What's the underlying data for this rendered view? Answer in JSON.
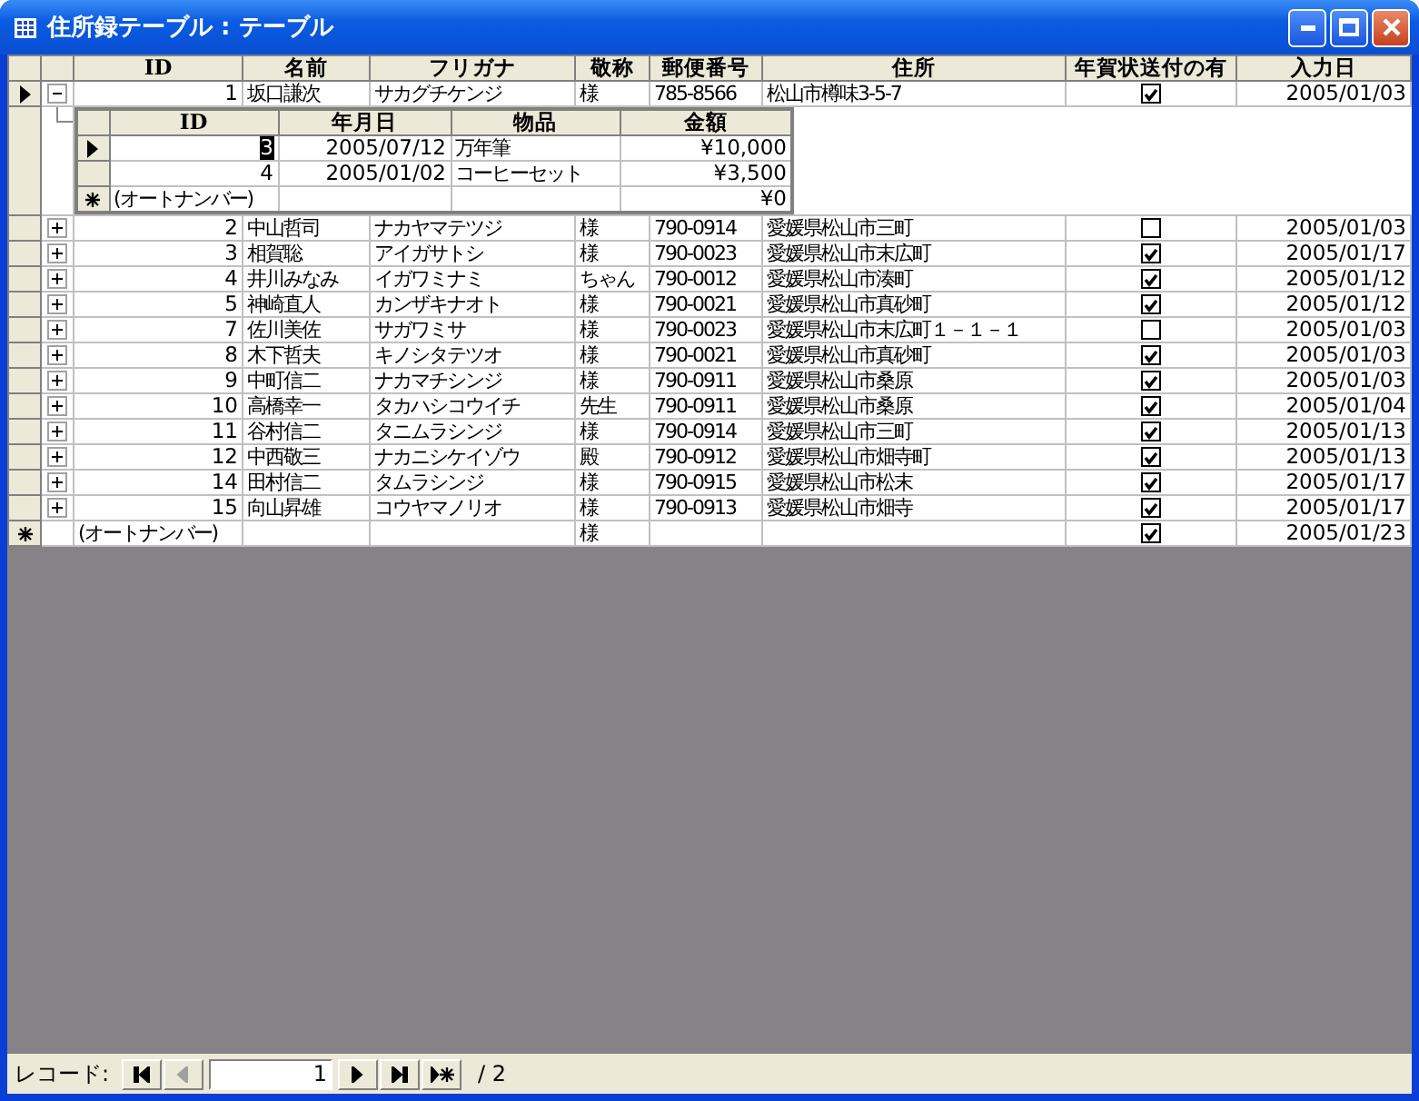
{
  "window": {
    "title": "住所録テーブル : テーブル"
  },
  "table": {
    "columns": [
      "ID",
      "名前",
      "フリガナ",
      "敬称",
      "郵便番号",
      "住所",
      "年賀状送付の有",
      "入力日"
    ],
    "rows": [
      {
        "kind": "record",
        "current": true,
        "expanded": true,
        "id": "1",
        "name": "坂口謙次",
        "kana": "サカグチケンジ",
        "title": "様",
        "zip": "785-8566",
        "address": "松山市樽味3-5-7",
        "nenga": true,
        "date": "2005/01/03",
        "subtable": {
          "columns": [
            "ID",
            "年月日",
            "物品",
            "金額"
          ],
          "rows": [
            {
              "kind": "record",
              "current": true,
              "id": "3",
              "date": "2005/07/12",
              "item": "万年筆",
              "amount": "¥10,000"
            },
            {
              "kind": "record",
              "current": false,
              "id": "4",
              "date": "2005/01/02",
              "item": "コーヒーセット",
              "amount": "¥3,500"
            },
            {
              "kind": "new",
              "current": false,
              "id": "(オートナンバー)",
              "date": "",
              "item": "",
              "amount": "¥0"
            }
          ]
        }
      },
      {
        "kind": "record",
        "current": false,
        "expanded": false,
        "id": "2",
        "name": "中山哲司",
        "kana": "ナカヤマテツジ",
        "title": "様",
        "zip": "790-0914",
        "address": "愛媛県松山市三町",
        "nenga": false,
        "date": "2005/01/03"
      },
      {
        "kind": "record",
        "current": false,
        "expanded": false,
        "id": "3",
        "name": "相賀聡",
        "kana": "アイガサトシ",
        "title": "様",
        "zip": "790-0023",
        "address": "愛媛県松山市末広町",
        "nenga": true,
        "date": "2005/01/17"
      },
      {
        "kind": "record",
        "current": false,
        "expanded": false,
        "id": "4",
        "name": "井川みなみ",
        "kana": "イガワミナミ",
        "title": "ちゃん",
        "zip": "790-0012",
        "address": "愛媛県松山市湊町",
        "nenga": true,
        "date": "2005/01/12"
      },
      {
        "kind": "record",
        "current": false,
        "expanded": false,
        "id": "5",
        "name": "神崎直人",
        "kana": "カンザキナオト",
        "title": "様",
        "zip": "790-0021",
        "address": "愛媛県松山市真砂町",
        "nenga": true,
        "date": "2005/01/12"
      },
      {
        "kind": "record",
        "current": false,
        "expanded": false,
        "id": "7",
        "name": "佐川美佐",
        "kana": "サガワミサ",
        "title": "様",
        "zip": "790-0023",
        "address": "愛媛県松山市末広町１－１－１",
        "nenga": false,
        "date": "2005/01/03"
      },
      {
        "kind": "record",
        "current": false,
        "expanded": false,
        "id": "8",
        "name": "木下哲夫",
        "kana": "キノシタテツオ",
        "title": "様",
        "zip": "790-0021",
        "address": "愛媛県松山市真砂町",
        "nenga": true,
        "date": "2005/01/03"
      },
      {
        "kind": "record",
        "current": false,
        "expanded": false,
        "id": "9",
        "name": "中町信二",
        "kana": "ナカマチシンジ",
        "title": "様",
        "zip": "790-0911",
        "address": "愛媛県松山市桑原",
        "nenga": true,
        "date": "2005/01/03"
      },
      {
        "kind": "record",
        "current": false,
        "expanded": false,
        "id": "10",
        "name": "高橋幸一",
        "kana": "タカハシコウイチ",
        "title": "先生",
        "zip": "790-0911",
        "address": "愛媛県松山市桑原",
        "nenga": true,
        "date": "2005/01/04"
      },
      {
        "kind": "record",
        "current": false,
        "expanded": false,
        "id": "11",
        "name": "谷村信二",
        "kana": "タニムラシンジ",
        "title": "様",
        "zip": "790-0914",
        "address": "愛媛県松山市三町",
        "nenga": true,
        "date": "2005/01/13"
      },
      {
        "kind": "record",
        "current": false,
        "expanded": false,
        "id": "12",
        "name": "中西敬三",
        "kana": "ナカニシケイゾウ",
        "title": "殿",
        "zip": "790-0912",
        "address": "愛媛県松山市畑寺町",
        "nenga": true,
        "date": "2005/01/13"
      },
      {
        "kind": "record",
        "current": false,
        "expanded": false,
        "id": "14",
        "name": "田村信二",
        "kana": "タムラシンジ",
        "title": "様",
        "zip": "790-0915",
        "address": "愛媛県松山市松末",
        "nenga": true,
        "date": "2005/01/17"
      },
      {
        "kind": "record",
        "current": false,
        "expanded": false,
        "id": "15",
        "name": "向山昇雄",
        "kana": "コウヤマノリオ",
        "title": "様",
        "zip": "790-0913",
        "address": "愛媛県松山市畑寺",
        "nenga": true,
        "date": "2005/01/17"
      },
      {
        "kind": "new",
        "current": false,
        "id": "(オートナンバー)",
        "name": "",
        "kana": "",
        "title": "様",
        "zip": "",
        "address": "",
        "nenga": true,
        "date": "2005/01/23"
      }
    ]
  },
  "navigation": {
    "label": "レコード:",
    "record": "1",
    "total": "/ 2",
    "buttons": [
      {
        "kind": "first",
        "disabled": false
      },
      {
        "kind": "prev",
        "disabled": true
      },
      {
        "kind": "field"
      },
      {
        "kind": "next",
        "disabled": false
      },
      {
        "kind": "last",
        "disabled": false
      },
      {
        "kind": "new",
        "disabled": false
      }
    ]
  }
}
